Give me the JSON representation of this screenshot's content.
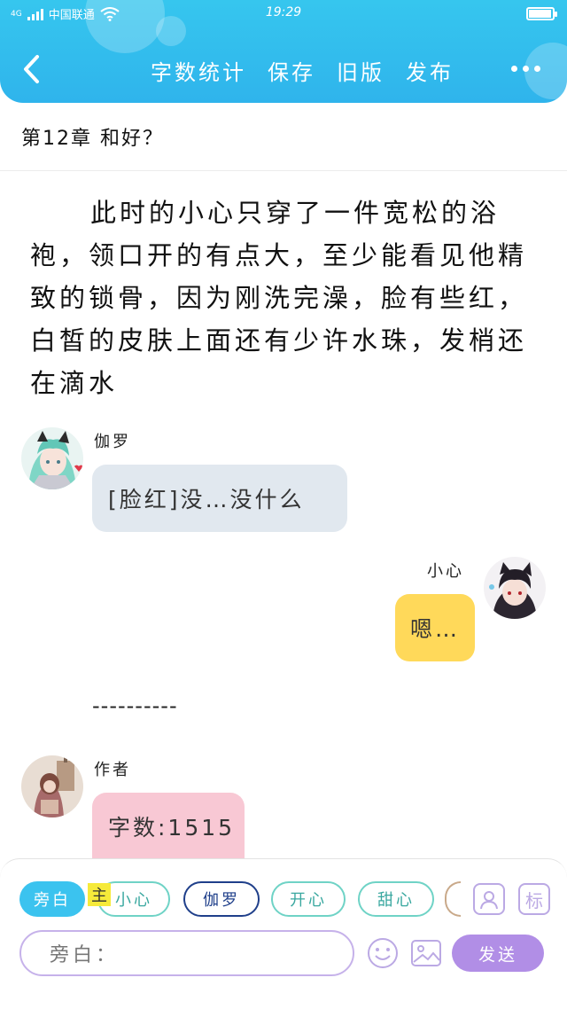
{
  "status_bar": {
    "carrier": "中国联通",
    "network": "4G",
    "time": "19:29",
    "battery_level": 0.95
  },
  "header": {
    "tools": [
      "字数统计",
      "保存",
      "旧版",
      "发布"
    ],
    "accent": "#2fb4ec"
  },
  "chapter_title": "第12章 和好？",
  "narration": "此时的小心只穿了一件宽松的浴袍，领口开的有点大，至少能看见他精致的锁骨，因为刚洗完澡，脸有些红，白皙的皮肤上面还有少许水珠，发梢还在滴水",
  "messages": [
    {
      "speaker": "伽罗",
      "text": "[脸红]没…没什么",
      "bubble_color": "#e1e8ef"
    },
    {
      "speaker": "小心",
      "text": "嗯…",
      "bubble_color": "#ffd95a"
    }
  ],
  "separator": "----------",
  "author_message": {
    "speaker": "作者",
    "text": "字数:1515",
    "bubble_color": "#f8c8d4"
  },
  "role_bar": {
    "chips": [
      {
        "label": "旁白",
        "selected": true
      },
      {
        "label": "小心",
        "badge": "主"
      },
      {
        "label": "伽罗"
      },
      {
        "label": "开心"
      },
      {
        "label": "甜心"
      }
    ],
    "icons": [
      "character-icon",
      "tag-icon"
    ],
    "tag_label": "标"
  },
  "composer": {
    "placeholder": "旁白：",
    "send_label": "发送",
    "send_color": "#b18ee6"
  }
}
